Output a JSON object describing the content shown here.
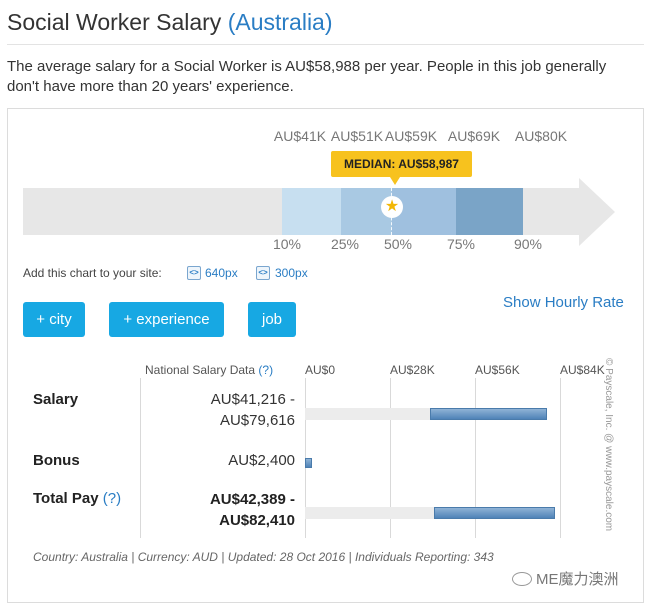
{
  "header": {
    "title": "Social Worker Salary",
    "country": "(Australia)"
  },
  "intro": "The average salary for a Social Worker is AU$58,988 per year. People in this job generally don't have more than 20 years' experience.",
  "percentile_chart": {
    "top_labels": [
      "AU$41K",
      "AU$51K",
      "AU$59K",
      "AU$69K",
      "AU$80K"
    ],
    "percentiles": [
      "10%",
      "25%",
      "50%",
      "75%",
      "90%"
    ],
    "median_label": "MEDIAN: AU$58,987",
    "segment_colors": [
      "#c7dff0",
      "#a9c9e3",
      "#9fc0df",
      "#7aa4c7"
    ]
  },
  "embed": {
    "label": "Add this chart to your site:",
    "small": "640px",
    "large": "300px"
  },
  "buttons": {
    "city": "+ city",
    "experience": "+ experience",
    "job": "job",
    "hourly": "Show Hourly Rate"
  },
  "table": {
    "header": "National Salary Data",
    "help": "(?)",
    "axis": [
      "AU$0",
      "AU$28K",
      "AU$56K",
      "AU$84K"
    ],
    "axis_max": 84000,
    "rows": [
      {
        "label": "Salary",
        "value_line1": "AU$41,216 -",
        "value_line2": "AU$79,616",
        "min": 41216,
        "max": 79616
      },
      {
        "label": "Bonus",
        "value_line1": "AU$2,400",
        "min": 0,
        "max": 2400
      },
      {
        "label": "Total Pay",
        "help": "(?)",
        "value_line1": "AU$42,389 -",
        "value_line2": "AU$82,410",
        "min": 42389,
        "max": 82410
      }
    ]
  },
  "copyright": "© Payscale, Inc. @ www.payscale.com",
  "footer": "Country: Australia | Currency: AUD | Updated: 28 Oct 2016 | Individuals Reporting: 343",
  "watermark": "ME魔力澳洲",
  "colors": {
    "accent": "#2a7dc4",
    "button": "#17a8e3",
    "median": "#f7c21e"
  }
}
